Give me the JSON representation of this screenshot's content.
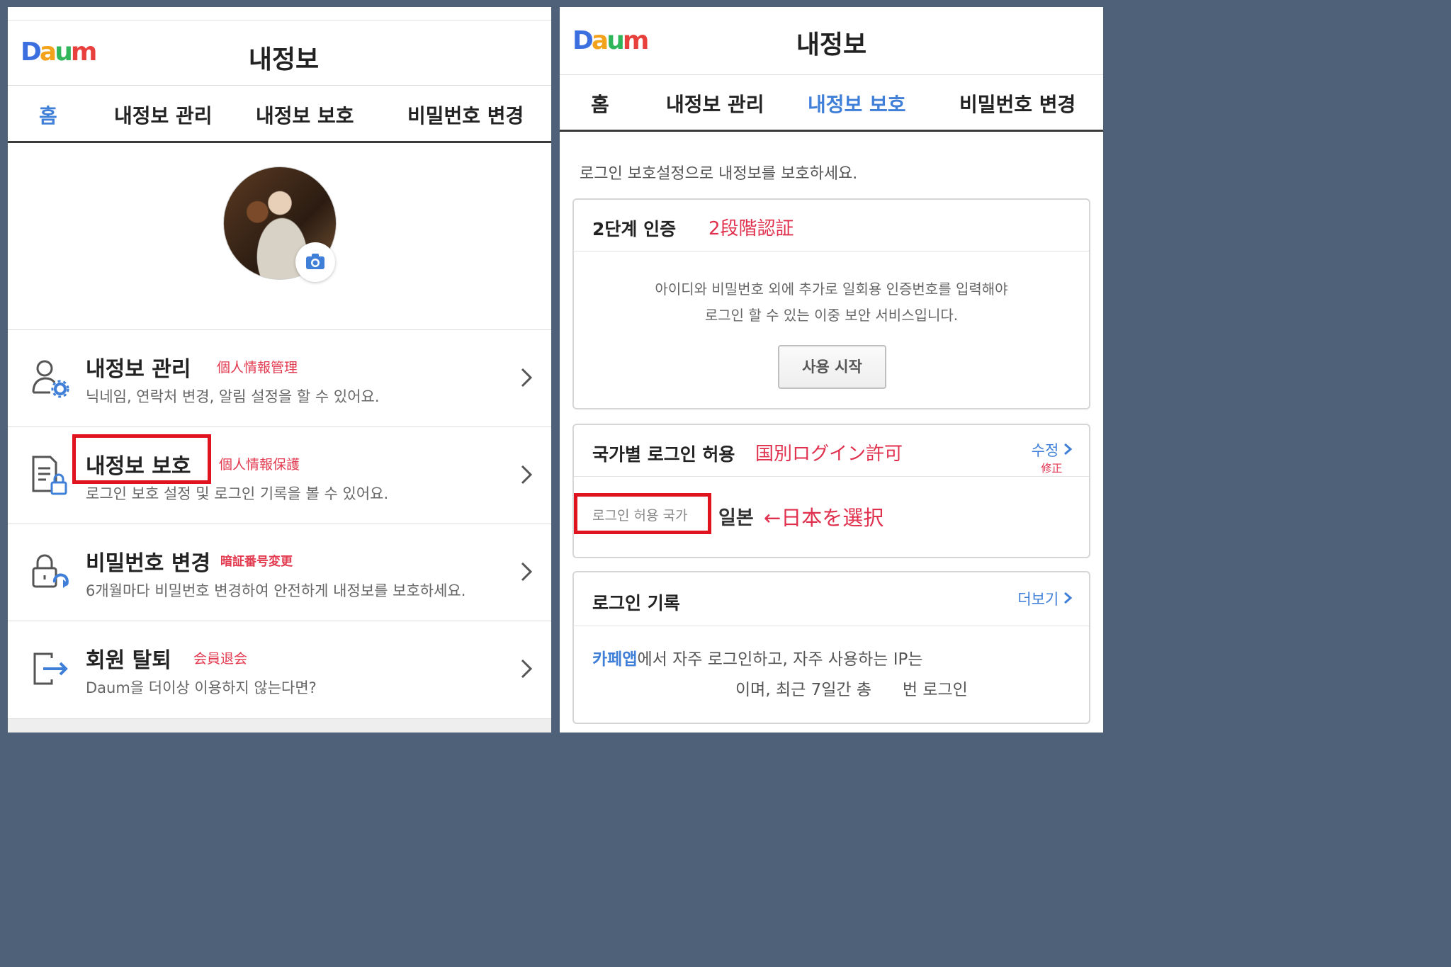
{
  "left": {
    "logo": [
      "D",
      "a",
      "u",
      "m"
    ],
    "title": "내정보",
    "tabs": [
      "홈",
      "내정보 관리",
      "내정보 보호",
      "비밀번호 변경"
    ],
    "menu": [
      {
        "title": "내정보 관리",
        "note": "個人情報管理",
        "desc": "닉네임, 연락처 변경, 알림 설정을 할 수 있어요.",
        "icon": "user-settings-icon"
      },
      {
        "title": "내정보 보호",
        "note": "個人情報保護",
        "desc": "로그인 보호 설정 및 로그인 기록을 볼 수 있어요.",
        "icon": "document-lock-icon"
      },
      {
        "title": "비밀번호 변경",
        "note": "暗証番号変更",
        "desc": "6개월마다 비밀번호 변경하여 안전하게 내정보를 보호하세요.",
        "icon": "lock-refresh-icon"
      },
      {
        "title": "회원 탈퇴",
        "note": "会員退会",
        "desc": "Daum을 더이상 이용하지 않는다면?",
        "icon": "exit-icon"
      }
    ]
  },
  "right": {
    "logo": [
      "D",
      "a",
      "u",
      "m"
    ],
    "title": "내정보",
    "tabs": [
      "홈",
      "내정보 관리",
      "내정보 보호",
      "비밀번호 변경"
    ],
    "intro": "로그인 보호설정으로 내정보를 보호하세요.",
    "two_step": {
      "title": "2단계 인증",
      "jp": "2段階認証",
      "line1": "아이디와 비밀번호 외에 추가로 일회용 인증번호를 입력해야",
      "line2": "로그인 할 수 있는 이중 보안 서비스입니다.",
      "button": "사용 시작"
    },
    "country": {
      "title": "국가별 로그인 허용",
      "jp": "国別ログイン許可",
      "edit": "수정",
      "edit_jp": "修正",
      "label": "로그인 허용 국가",
      "value": "일본",
      "annotation": "←日本を選択"
    },
    "history": {
      "title": "로그인 기록",
      "more": "더보기",
      "app": "카페앱",
      "line1_rest": "에서 자주 로그인하고, 자주 사용하는 IP는",
      "line2": "이며, 최근 7일간 총      번 로그인"
    }
  },
  "colors": {
    "accent": "#3f7fd8",
    "annotation_red": "#e0141f",
    "jp_text": "#e0304d",
    "background": "#4f6079"
  }
}
